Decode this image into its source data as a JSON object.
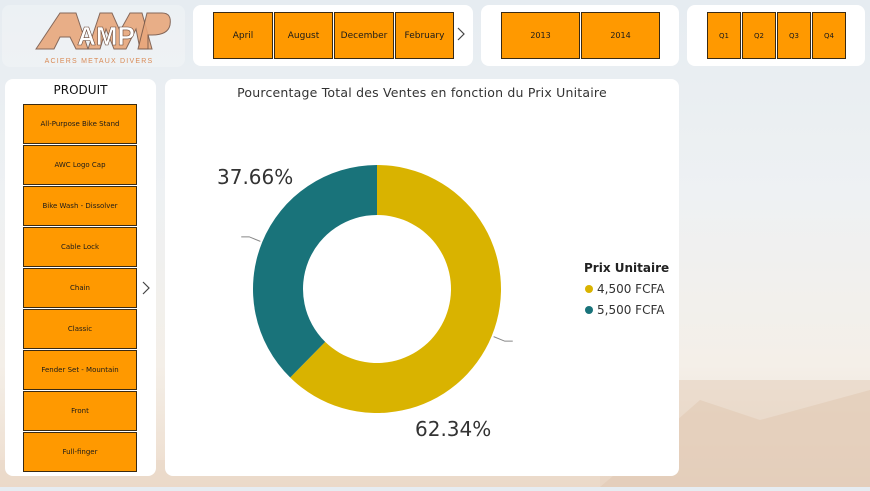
{
  "logo": {
    "letters": "AMP",
    "tagline": "ACIERS METAUX DIVERS"
  },
  "months": [
    "April",
    "August",
    "December",
    "February"
  ],
  "years": [
    "2013",
    "2014"
  ],
  "quarters": [
    "Q1",
    "Q2",
    "Q3",
    "Q4"
  ],
  "produit": {
    "title": "PRODUIT",
    "items": [
      "All-Purpose Bike Stand",
      "AWC Logo Cap",
      "Bike Wash - Dissolver",
      "Cable Lock",
      "Chain",
      "Classic",
      "Fender Set - Mountain",
      "Front",
      "Full-finger"
    ]
  },
  "colors": {
    "accent": "#ff9900",
    "series1": "#d9b300",
    "series2": "#19737a"
  },
  "chart_data": {
    "type": "pie",
    "title": "Pourcentage Total des Ventes en fonction du Prix Unitaire",
    "legend_title": "Prix Unitaire",
    "legend_position": "right",
    "slices": [
      {
        "name": "4,500 FCFA",
        "value": 62.34,
        "label": "62.34%",
        "color": "#d9b300"
      },
      {
        "name": "5,500 FCFA",
        "value": 37.66,
        "label": "37.66%",
        "color": "#19737a"
      }
    ]
  }
}
